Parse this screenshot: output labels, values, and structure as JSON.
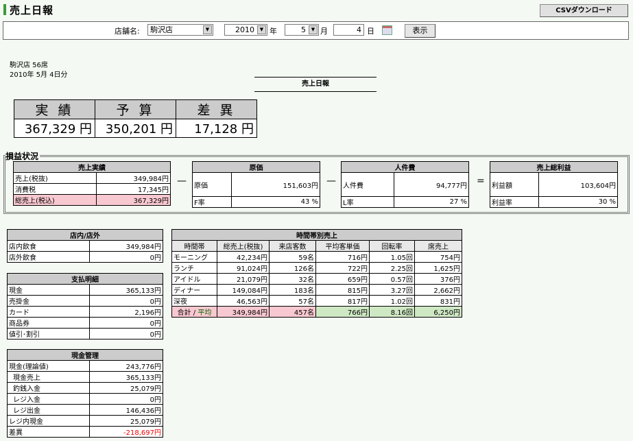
{
  "header": {
    "title": "売上日報",
    "csv_button": "CSVダウンロード"
  },
  "filter": {
    "store_label": "店舗名:",
    "store_value": "駒沢店",
    "year_value": "2010",
    "year_unit": "年",
    "month_value": "5",
    "month_unit": "月",
    "day_value": "4",
    "day_unit": "日",
    "show_button": "表示"
  },
  "info": {
    "store_line": "駒沢店  56席",
    "date_line": "2010年 5月 4日分"
  },
  "report_title": "売上日報",
  "summary": {
    "headers": [
      "実 績",
      "予 算",
      "差 異"
    ],
    "values": [
      "367,329 円",
      "350,201 円",
      "17,128 円"
    ]
  },
  "pl": {
    "title": "損益状況",
    "sales": {
      "header": "売上実績",
      "rows": [
        [
          "売上(税抜)",
          "349,984円"
        ],
        [
          "消費税",
          "17,345円"
        ],
        [
          "総売上(税込)",
          "367,329円"
        ]
      ]
    },
    "cost": {
      "header": "原価",
      "rows": [
        [
          "原価",
          "151,603円"
        ],
        [
          "F率",
          "43 %"
        ]
      ]
    },
    "labor": {
      "header": "人件費",
      "rows": [
        [
          "人件費",
          "94,777円"
        ],
        [
          "L率",
          "27 %"
        ]
      ]
    },
    "profit": {
      "header": "売上総利益",
      "rows": [
        [
          "利益額",
          "103,604円"
        ],
        [
          "利益率",
          "30 %"
        ]
      ]
    },
    "ops": [
      "—",
      "—",
      "="
    ]
  },
  "inout": {
    "header": "店内/店外",
    "rows": [
      [
        "店内飲食",
        "349,984円"
      ],
      [
        "店外飲食",
        "0円"
      ]
    ]
  },
  "payment": {
    "header": "支払明細",
    "rows": [
      [
        "現金",
        "365,133円"
      ],
      [
        "売掛金",
        "0円"
      ],
      [
        "カード",
        "2,196円"
      ],
      [
        "商品券",
        "0円"
      ],
      [
        "値引･割引",
        "0円"
      ]
    ]
  },
  "cash": {
    "header": "現金管理",
    "rows": [
      [
        "現金(理論値)",
        "243,776円"
      ],
      [
        "現金売上",
        "365,133円"
      ],
      [
        "釣銭入金",
        "25,079円"
      ],
      [
        "レジ入金",
        "0円"
      ],
      [
        "レジ出金",
        "146,436円"
      ],
      [
        "レジ内現金",
        "25,079円"
      ],
      [
        "差異",
        "-218,697円"
      ]
    ]
  },
  "hourly": {
    "header": "時間帯別売上",
    "columns": [
      "時間帯",
      "総売上(税抜)",
      "来店客数",
      "平均客単価",
      "回転率",
      "席売上"
    ],
    "rows": [
      [
        "モーニング",
        "42,234円",
        "59名",
        "716円",
        "1.05回",
        "754円"
      ],
      [
        "ランチ",
        "91,024円",
        "126名",
        "722円",
        "2.25回",
        "1,625円"
      ],
      [
        "アイドル",
        "21,079円",
        "32名",
        "659円",
        "0.57回",
        "376円"
      ],
      [
        "ディナー",
        "149,084円",
        "183名",
        "815円",
        "3.27回",
        "2,662円"
      ],
      [
        "深夜",
        "46,563円",
        "57名",
        "817円",
        "1.02回",
        "831円"
      ]
    ],
    "total_label_a": "合計",
    "total_label_b": "平均",
    "total": [
      "349,984円",
      "457名",
      "766円",
      "8.16回",
      "6,250円"
    ]
  },
  "colors": {
    "accent": "#3a9a3a",
    "pink": "#f8c8d0",
    "green_total": "#cfe8c4",
    "red": "#e00000"
  }
}
